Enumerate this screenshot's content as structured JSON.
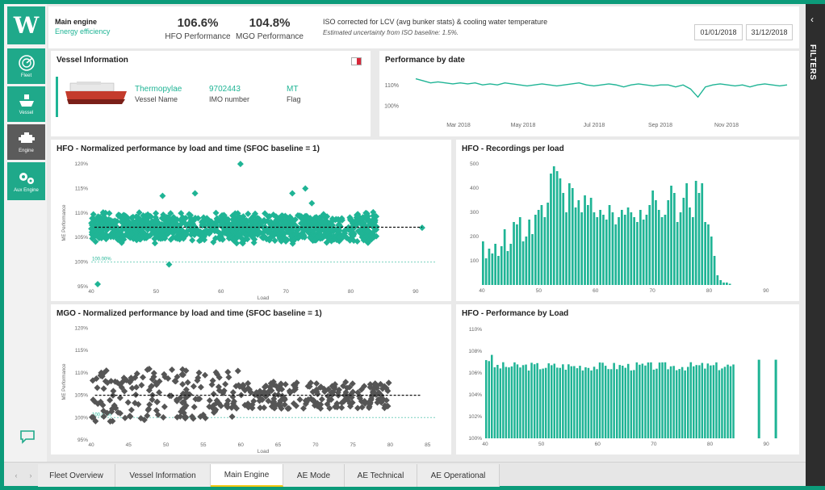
{
  "header": {
    "engine_title": "Main engine",
    "engine_subtitle": "Energy efficiency",
    "kpis": [
      {
        "value": "106.6%",
        "label": "HFO Performance"
      },
      {
        "value": "104.8%",
        "label": "MGO Performance"
      }
    ],
    "note_title": "ISO corrected for LCV (avg bunker stats) & cooling water temperature",
    "note_sub": "Estimated uncertainty from ISO baseline: 1.5%.",
    "date_from": "01/01/2018",
    "date_to": "31/12/2018"
  },
  "sidebar": {
    "items": [
      {
        "label": "Fleet",
        "icon": "radar-icon"
      },
      {
        "label": "Vessel",
        "icon": "ship-icon"
      },
      {
        "label": "Engine",
        "icon": "engine-icon"
      },
      {
        "label": "Aux Engine",
        "icon": "gears-icon"
      }
    ],
    "active": "Engine"
  },
  "vessel": {
    "title": "Vessel Information",
    "name": "Thermopylae",
    "name_label": "Vessel Name",
    "imo": "9702443",
    "imo_label": "IMO number",
    "flag": "MT",
    "flag_label": "Flag",
    "flag_color": "#d7283a"
  },
  "filters_label": "FILTERS",
  "tabs": [
    "Fleet Overview",
    "Vessel Information",
    "Main Engine",
    "AE Mode",
    "AE Technical",
    "AE Operational"
  ],
  "active_tab": "Main Engine",
  "colors": {
    "accent": "#1fb495",
    "dark": "#555555"
  },
  "chart_data": [
    {
      "type": "line",
      "title": "Performance by date",
      "y_ticks": [
        "110%",
        "100%"
      ],
      "x_ticks": [
        "Mar 2018",
        "May 2018",
        "Jul 2018",
        "Sep 2018",
        "Nov 2018"
      ],
      "series": [
        {
          "values": [
            113,
            112,
            111,
            111.5,
            111,
            110.5,
            111,
            110.5,
            111,
            110,
            110.5,
            110,
            111,
            110.5,
            110,
            109.5,
            110,
            110.5,
            110,
            109.5,
            110,
            110.5,
            111,
            110,
            109.5,
            110,
            110.5,
            110,
            109,
            110,
            110.5,
            110,
            109.5,
            110,
            110,
            109,
            110,
            108,
            104,
            109,
            110,
            110.5,
            110,
            109.5,
            110,
            109,
            110,
            110.5,
            110,
            109.5,
            110
          ]
        }
      ],
      "ylim": [
        95,
        118
      ]
    },
    {
      "type": "scatter",
      "title": "HFO - Normalized performance by load and time (SFOC baseline = 1)",
      "ylabel": "ME Performance",
      "xlabel": "Load",
      "x_ticks": [
        40,
        50,
        60,
        70,
        80,
        90
      ],
      "y_ticks": [
        "120%",
        "115%",
        "110%",
        "105%",
        "100%",
        "95%"
      ],
      "xlim": [
        40,
        93
      ],
      "ylim": [
        95,
        121
      ],
      "baseline_label": "100.00%",
      "trend": 107.1,
      "outliers": [
        [
          63,
          120
        ],
        [
          51,
          113.5
        ],
        [
          56,
          114
        ],
        [
          73,
          115
        ],
        [
          71,
          114
        ],
        [
          74,
          112
        ],
        [
          52,
          99.5
        ],
        [
          41,
          95.5
        ],
        [
          91,
          107
        ]
      ]
    },
    {
      "type": "bar",
      "title": "HFO - Recordings per load",
      "y_ticks": [
        500,
        400,
        300,
        200,
        100
      ],
      "x_ticks": [
        40,
        50,
        60,
        70,
        80,
        90
      ],
      "ylim": [
        0,
        520
      ],
      "xlim": [
        40,
        93
      ],
      "values": [
        180,
        110,
        150,
        130,
        170,
        120,
        160,
        230,
        140,
        170,
        260,
        250,
        280,
        180,
        200,
        270,
        210,
        290,
        310,
        330,
        280,
        340,
        460,
        490,
        470,
        440,
        380,
        300,
        420,
        400,
        320,
        350,
        300,
        370,
        330,
        360,
        300,
        280,
        310,
        290,
        270,
        330,
        300,
        250,
        280,
        310,
        290,
        320,
        300,
        280,
        260,
        310,
        270,
        290,
        330,
        390,
        350,
        310,
        280,
        290,
        350,
        410,
        380,
        260,
        300,
        360,
        420,
        320,
        280,
        430,
        380,
        420,
        260,
        250,
        200,
        120,
        40,
        20,
        10,
        10,
        5
      ]
    },
    {
      "type": "scatter",
      "title": "MGO - Normalized performance by load and time (SFOC baseline = 1)",
      "ylabel": "ME Performance",
      "xlabel": "Load",
      "x_ticks": [
        40,
        45,
        50,
        55,
        60,
        65,
        70,
        75,
        80,
        85
      ],
      "y_ticks": [
        "120%",
        "115%",
        "110%",
        "105%",
        "100%",
        "95%"
      ],
      "xlim": [
        40,
        86
      ],
      "ylim": [
        95,
        121
      ],
      "baseline_label": "100.00%",
      "trend": 105.0
    },
    {
      "type": "bar",
      "title": "HFO - Performance by Load",
      "y_ticks": [
        "110%",
        "108%",
        "106%",
        "104%",
        "102%",
        "100%"
      ],
      "x_ticks": [
        40,
        50,
        60,
        70,
        80,
        90
      ],
      "ylim": [
        100,
        110.5
      ],
      "xlim": [
        40,
        93
      ]
    }
  ]
}
